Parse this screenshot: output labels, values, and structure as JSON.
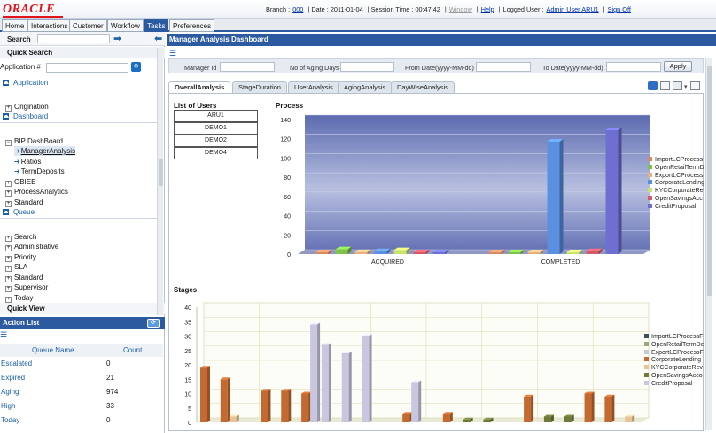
{
  "topbar": {
    "brand": "ORACLE",
    "branch_label": "Branch :",
    "branch_value": "000",
    "date_label": "| Date : 2011-01-04",
    "session_label": "| Session Time : 00:47:42",
    "window_label": "Window",
    "help_label": "Help",
    "logged_user_label": "Logged User :",
    "logged_user_value": "Admin User ARU1",
    "signoff_label": "Sign Off"
  },
  "tabs": [
    "Home",
    "Interactions",
    "Customer",
    "Workflow",
    "Tasks",
    "Preferences"
  ],
  "active_tab": "Tasks",
  "left": {
    "search_label": "Search",
    "quick_search_label": "Quick Search",
    "application_label": "Application #",
    "sections": {
      "application": "Application",
      "dashboard": "Dashboard",
      "queue": "Queue"
    },
    "origination": "Origination",
    "bip_dashboard": "BIP DashBoard",
    "bip_children": [
      "ManagerAnalysis",
      "Ratios",
      "TermDeposits"
    ],
    "dashboard_items": [
      "OBIEE",
      "ProcessAnalytics",
      "Standard"
    ],
    "queue_items": [
      "Search",
      "Administrative",
      "Priority",
      "SLA",
      "Standard",
      "Supervisor",
      "Today"
    ],
    "quick_view_label": "Quick View",
    "action_list_label": "Action List",
    "action_columns": [
      "Queue Name",
      "Count"
    ],
    "action_rows": [
      {
        "name": "Escalated",
        "count": "0"
      },
      {
        "name": "Expired",
        "count": "21"
      },
      {
        "name": "Aging",
        "count": "974"
      },
      {
        "name": "High",
        "count": "33"
      },
      {
        "name": "Today",
        "count": "0"
      }
    ]
  },
  "main": {
    "title": "Manager Analysis Dashboard",
    "filters": {
      "manager_id": "Manager Id",
      "aging_days": "No of Aging Days",
      "from_date": "From Date(yyyy-MM-dd)",
      "to_date": "To Date(yyyy-MM-dd)",
      "apply": "Apply"
    },
    "dash_tabs": [
      "OverallAnalysis",
      "StageDuration",
      "UserAnalysis",
      "AgingAnalysis",
      "DayWiseAnalysis"
    ],
    "active_dash_tab": "OverallAnalysis",
    "list_of_users_title": "List of Users",
    "users": [
      "ARU1",
      "DEMO1",
      "DEMO2",
      "DEMO4"
    ]
  },
  "chart_data": [
    {
      "type": "bar",
      "title": "Process",
      "categories": [
        "ACQUIRED",
        "COMPLETED"
      ],
      "ylim": [
        0,
        140
      ],
      "yticks": [
        "0",
        "20",
        "40",
        "60",
        "80",
        "100",
        "120",
        "140"
      ],
      "series": [
        {
          "name": "ImportLCProcess",
          "color": "#d98a63",
          "values": [
            0,
            0
          ]
        },
        {
          "name": "OpenRetailTermD",
          "color": "#7ec24a",
          "values": [
            5,
            0
          ]
        },
        {
          "name": "ExportLCProcess",
          "color": "#e8b07a",
          "values": [
            2,
            0
          ]
        },
        {
          "name": "CorporateLending",
          "color": "#5b8fe0",
          "values": [
            3,
            117
          ]
        },
        {
          "name": "KYCCorporateRe",
          "color": "#c6e36b",
          "values": [
            4,
            0
          ]
        },
        {
          "name": "OpenSavingsAcc",
          "color": "#d45a6a",
          "values": [
            1,
            3
          ]
        },
        {
          "name": "CreditProposal",
          "color": "#6e6fd0",
          "values": [
            0,
            129
          ]
        }
      ]
    },
    {
      "type": "bar",
      "title": "Stages",
      "ylim": [
        0,
        40
      ],
      "yticks": [
        "0",
        "5",
        "10",
        "15",
        "20",
        "25",
        "30",
        "35",
        "40"
      ],
      "series": [
        {
          "name": "ImportLCProcessF",
          "color": "#3c4f5c",
          "values": []
        },
        {
          "name": "OpenRetailTermDe",
          "color": "#9aa77a",
          "values": []
        },
        {
          "name": "ExportLCProcessF",
          "color": "#c2ccd6",
          "values": []
        },
        {
          "name": "CorporateLending",
          "color": "#c46a30",
          "values": [
            19,
            15,
            0,
            11,
            11,
            10,
            0,
            0,
            0,
            0,
            3,
            0,
            3,
            0,
            0,
            0,
            9,
            0,
            0,
            10,
            9,
            0
          ]
        },
        {
          "name": "KYCCorporateRev",
          "color": "#e8c39a",
          "values": [
            0,
            2,
            0,
            0,
            0,
            0,
            0,
            0,
            0,
            0,
            0,
            0,
            0,
            0,
            0,
            0,
            0,
            0,
            0,
            0,
            0,
            2
          ]
        },
        {
          "name": "OpenSavingsAcco",
          "color": "#6f7a3a",
          "values": [
            0,
            0,
            0,
            0,
            0,
            0,
            0,
            0,
            0,
            0,
            0,
            0,
            0,
            1,
            1,
            0,
            0,
            2,
            2,
            0,
            0,
            0
          ]
        },
        {
          "name": "CreditProposal",
          "color": "#c9c7e0",
          "values": [
            0,
            0,
            0,
            0,
            0,
            34,
            27,
            24,
            30,
            0,
            14,
            0,
            0,
            0,
            0,
            0,
            0,
            0,
            0,
            0,
            0,
            0
          ]
        }
      ]
    }
  ]
}
